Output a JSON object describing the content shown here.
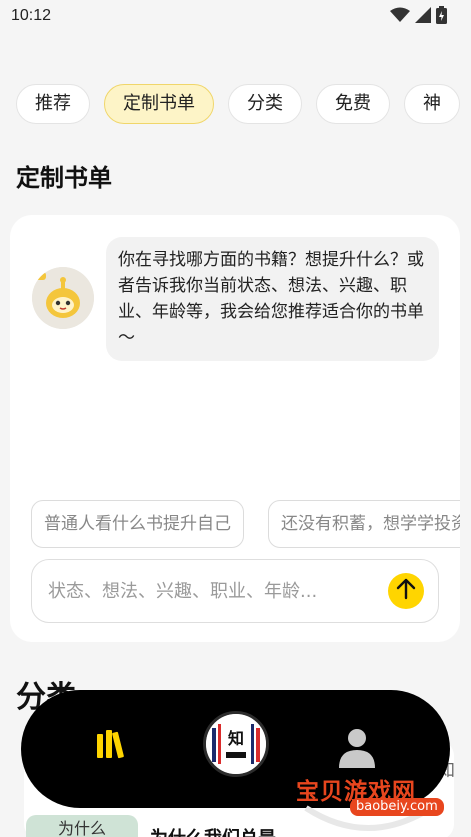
{
  "status_bar": {
    "time": "10:12"
  },
  "tabs": [
    {
      "label": "推荐",
      "active": false
    },
    {
      "label": "定制书单",
      "active": true
    },
    {
      "label": "分类",
      "active": false
    },
    {
      "label": "免费",
      "active": false
    },
    {
      "label": "神",
      "active": false
    }
  ],
  "custom_list": {
    "title": "定制书单",
    "assistant_message": "你在寻找哪方面的书籍？想提升什么？或者告诉我你当前状态、想法、兴趣、职业、年龄等，我会给您推荐适合你的书单～",
    "suggestions": [
      "普通人看什么书提升自己",
      "还没有积蓄，想学学投资"
    ],
    "input_placeholder": "状态、想法、兴趣、职业、年龄..."
  },
  "category": {
    "title": "分类",
    "book_cover_text": "为什么",
    "book_title": "为什么我们总是",
    "right_text": "知"
  },
  "bottom_nav": {
    "center_label": "知"
  },
  "watermark": {
    "main": "宝贝游戏网",
    "sub": "baobeiy.com"
  },
  "colors": {
    "accent_yellow": "#ffd500",
    "active_tab_bg": "#fdf4c7",
    "nav_bg": "#000000",
    "books_icon": "#ffd500"
  }
}
